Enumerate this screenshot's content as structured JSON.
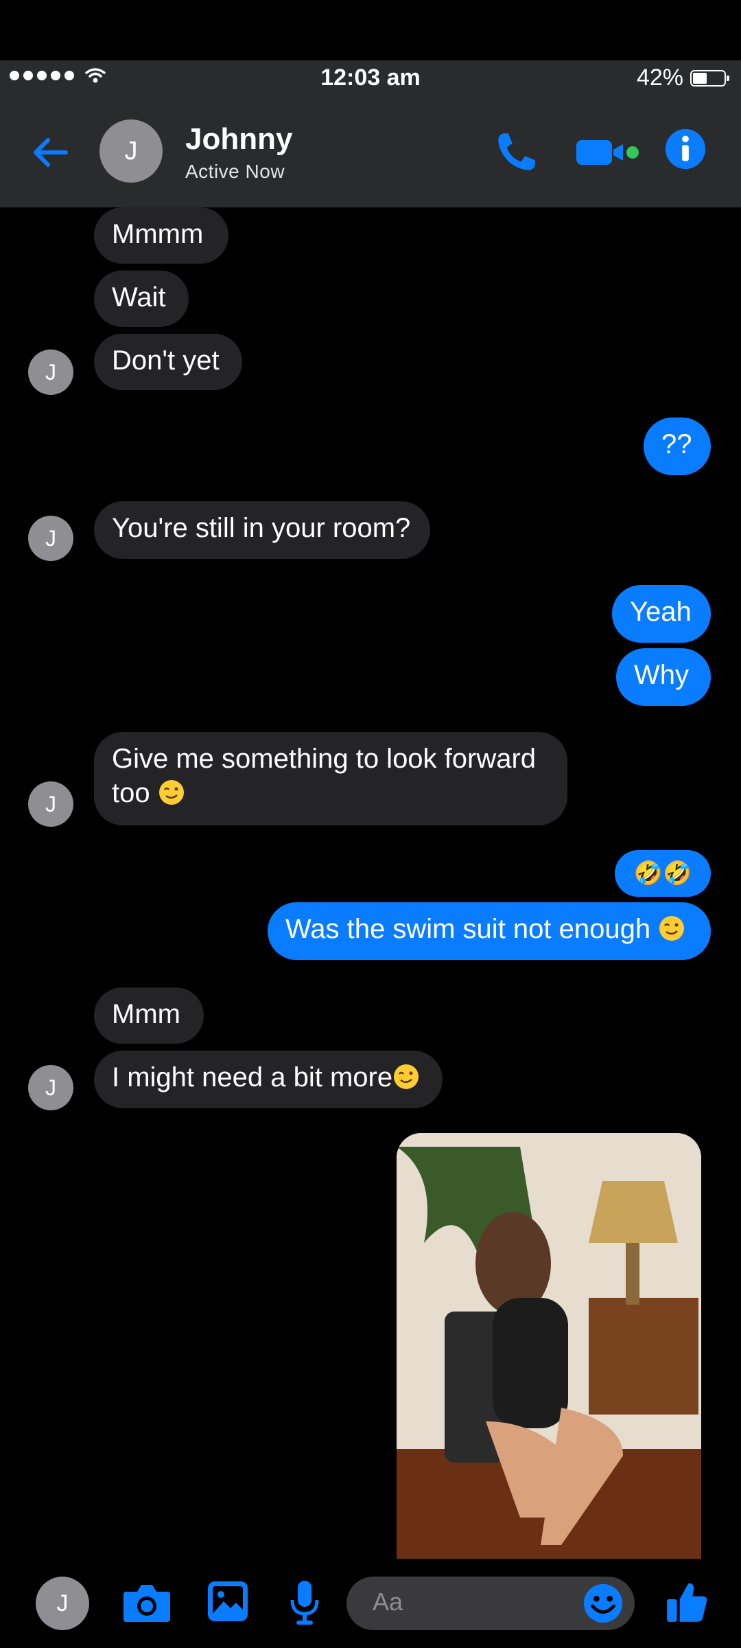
{
  "status_bar": {
    "time": "12:03 am",
    "battery": "42%",
    "battery_level": 0.42
  },
  "header": {
    "avatar_initial": "J",
    "contact_name": "Johnny",
    "contact_status": "Active Now",
    "icons": [
      "back-arrow-icon",
      "phone-icon",
      "video-camera-icon",
      "info-icon"
    ]
  },
  "messages": [
    {
      "from": "them",
      "text": "Mmmm"
    },
    {
      "from": "them",
      "text": "Wait"
    },
    {
      "from": "them",
      "text": "Don't yet"
    },
    {
      "from": "me",
      "text": "??"
    },
    {
      "from": "them",
      "text": "You're still in your room?"
    },
    {
      "from": "me",
      "text": "Yeah"
    },
    {
      "from": "me",
      "text": "Why"
    },
    {
      "from": "them",
      "text": "Give me something to look forward",
      "text2": "too"
    },
    {
      "from": "me",
      "text": "🤣🤣"
    },
    {
      "from": "me",
      "text": "Was the swim suit not enough"
    },
    {
      "from": "them",
      "text": "Mmm"
    },
    {
      "from": "them",
      "text": "I might need a bit more"
    },
    {
      "from": "me",
      "type": "photo"
    }
  ],
  "avatar_initial": "J",
  "composer": {
    "avatar_initial": "J",
    "placeholder": "Aa",
    "icons": [
      "camera-icon",
      "gallery-icon",
      "microphone-icon",
      "emoji-icon",
      "thumbs-up-icon"
    ]
  },
  "colors": {
    "accent": "#0a7cff",
    "incoming_bubble": "#242427",
    "header_bg": "#2a2b2d",
    "active_dot": "#34c759"
  }
}
